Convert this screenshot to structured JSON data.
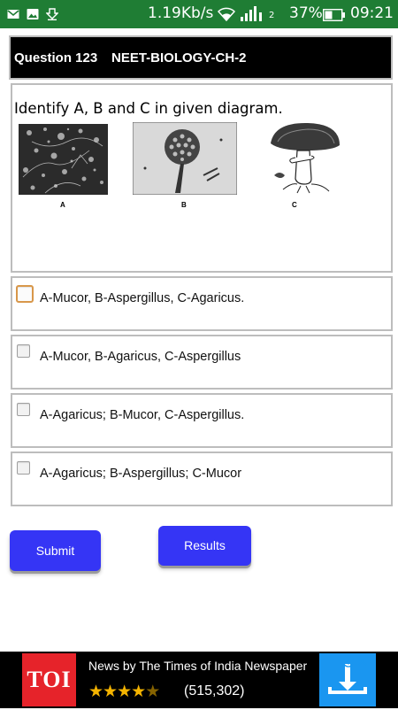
{
  "status_bar": {
    "speed": "1.19Kb/s",
    "battery_pct": "37%",
    "time": "09:21",
    "network_label": "2"
  },
  "question": {
    "number": "Question 123",
    "subject": "NEET-BIOLOGY-CH-2",
    "text": "Identify A, B and C in given diagram.",
    "figure_labels": [
      "A",
      "B",
      "C"
    ]
  },
  "options": [
    {
      "label": "A-Mucor, B-Aspergillus, C-Agaricus.",
      "checked": false,
      "focused": true
    },
    {
      "label": "A-Mucor, B-Agaricus, C-Aspergillus",
      "checked": false,
      "focused": false
    },
    {
      "label": "A-Agaricus; B-Mucor, C-Aspergillus.",
      "checked": false,
      "focused": false
    },
    {
      "label": "A-Agaricus; B-Aspergillus; C-Mucor",
      "checked": false,
      "focused": false
    }
  ],
  "buttons": {
    "submit": "Submit",
    "results": "Results"
  },
  "ad": {
    "logo": "TOI",
    "title": "News by The Times of India Newspaper",
    "rating_count": "(515,302)",
    "rating_stars": 4.5
  },
  "colors": {
    "status_bar": "#1f7d34",
    "button": "#3535f5",
    "ad_logo": "#e6232a",
    "ad_download": "#1a96f0"
  }
}
